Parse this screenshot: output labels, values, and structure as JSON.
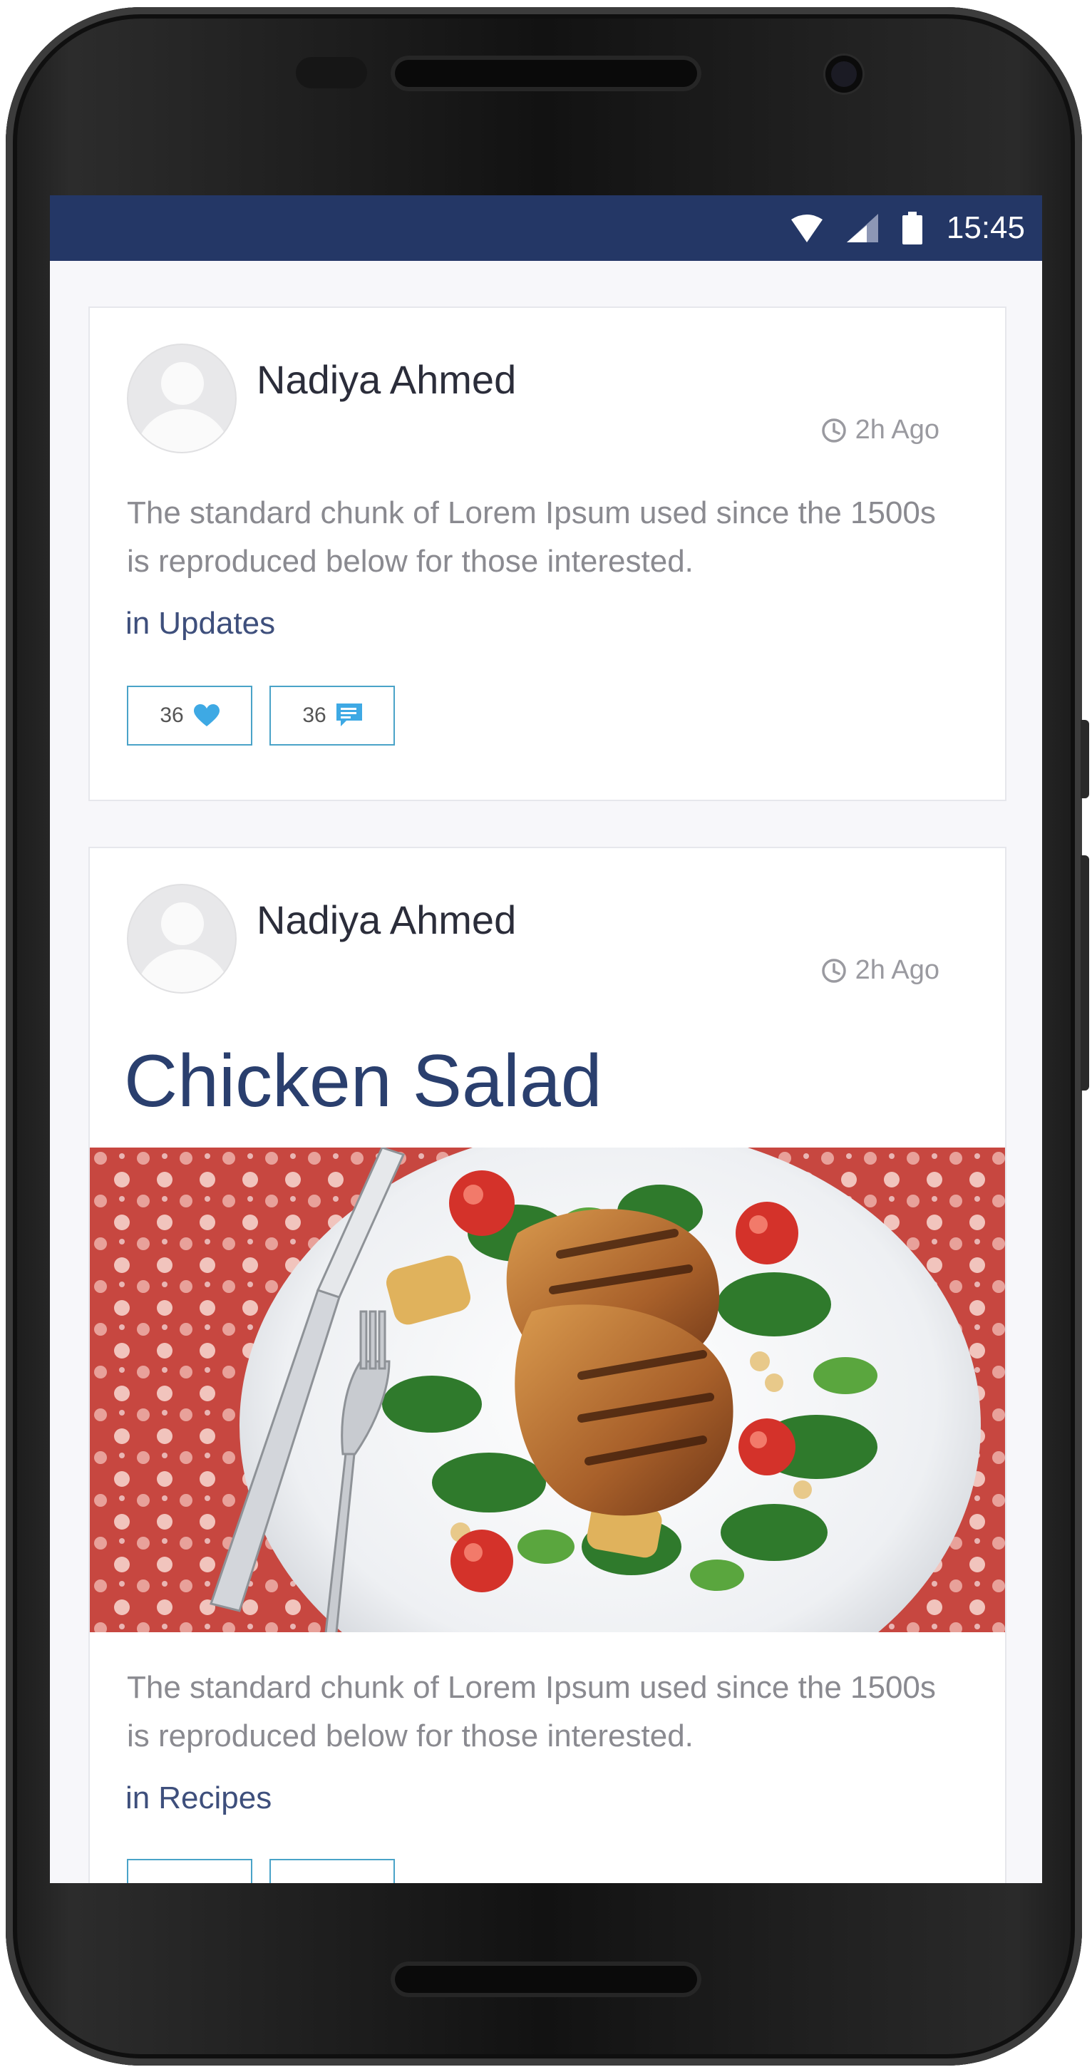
{
  "status_bar": {
    "time": "15:45",
    "icons": [
      "wifi-icon",
      "cellular-signal-icon",
      "battery-icon"
    ],
    "background": "#243766"
  },
  "posts": [
    {
      "author": "Nadiya Ahmed",
      "time": "2h Ago",
      "body": "The standard chunk of Lorem Ipsum used since the 1500s is reproduced below for those interested.",
      "category_prefix": "in",
      "category": "Updates",
      "likes": "36",
      "comments": "36"
    },
    {
      "author": "Nadiya Ahmed",
      "time": "2h Ago",
      "title": "Chicken Salad",
      "image": "grilled chicken salad photo",
      "body": "The standard chunk of Lorem Ipsum used since the 1500s is reproduced below for those interested.",
      "category_prefix": "in",
      "category": "Recipes"
    }
  ],
  "colors": {
    "accent": "#2a3f6e",
    "button_border": "#4aa3c8",
    "like_icon": "#3ea9e4",
    "comment_icon": "#3ea9e4"
  }
}
